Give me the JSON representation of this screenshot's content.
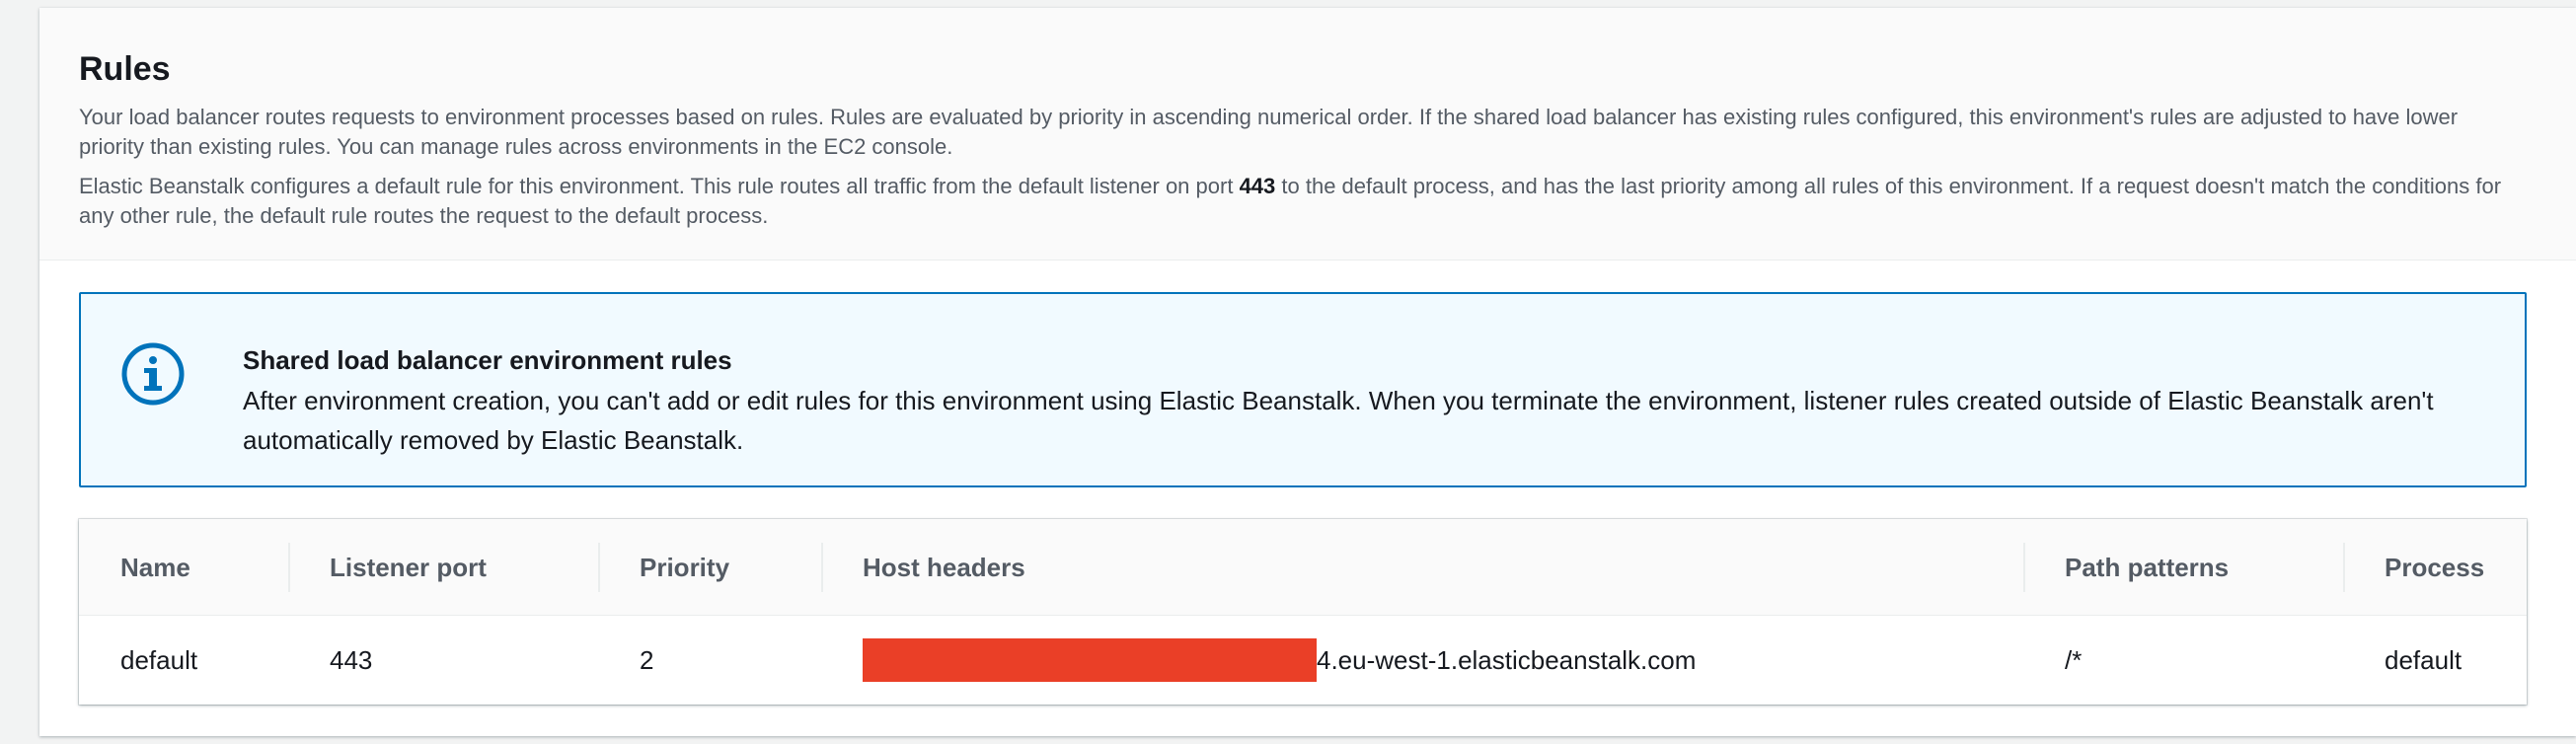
{
  "section": {
    "title": "Rules",
    "description_1": "Your load balancer routes requests to environment processes based on rules. Rules are evaluated by priority in ascending numerical order. If the shared load balancer has existing rules configured, this environment's rules are adjusted to have lower priority than existing rules. You can manage rules across environments in the EC2 console.",
    "description_2_before": "Elastic Beanstalk configures a default rule for this environment. This rule routes all traffic from the default listener on port ",
    "description_2_port": "443",
    "description_2_after": " to the default process, and has the last priority among all rules of this environment. If a request doesn't match the conditions for any other rule, the default rule routes the request to the default process."
  },
  "alert": {
    "icon": "info-icon",
    "title": "Shared load balancer environment rules",
    "body": "After environment creation, you can't add or edit rules for this environment using Elastic Beanstalk. When you terminate the environment, listener rules created outside of Elastic Beanstalk aren't automatically removed by Elastic Beanstalk."
  },
  "table": {
    "columns": {
      "name": "Name",
      "listener_port": "Listener port",
      "priority": "Priority",
      "host_headers": "Host headers",
      "path_patterns": "Path patterns",
      "process": "Process"
    },
    "rows": [
      {
        "name": "default",
        "listener_port": "443",
        "priority": "2",
        "host_header_visible_suffix": "4.eu-west-1.elasticbeanstalk.com",
        "path_patterns": "/*",
        "process": "default"
      }
    ]
  },
  "colors": {
    "info_accent": "#0073bb",
    "info_background": "#f1faff",
    "redaction": "#ea3f27"
  }
}
